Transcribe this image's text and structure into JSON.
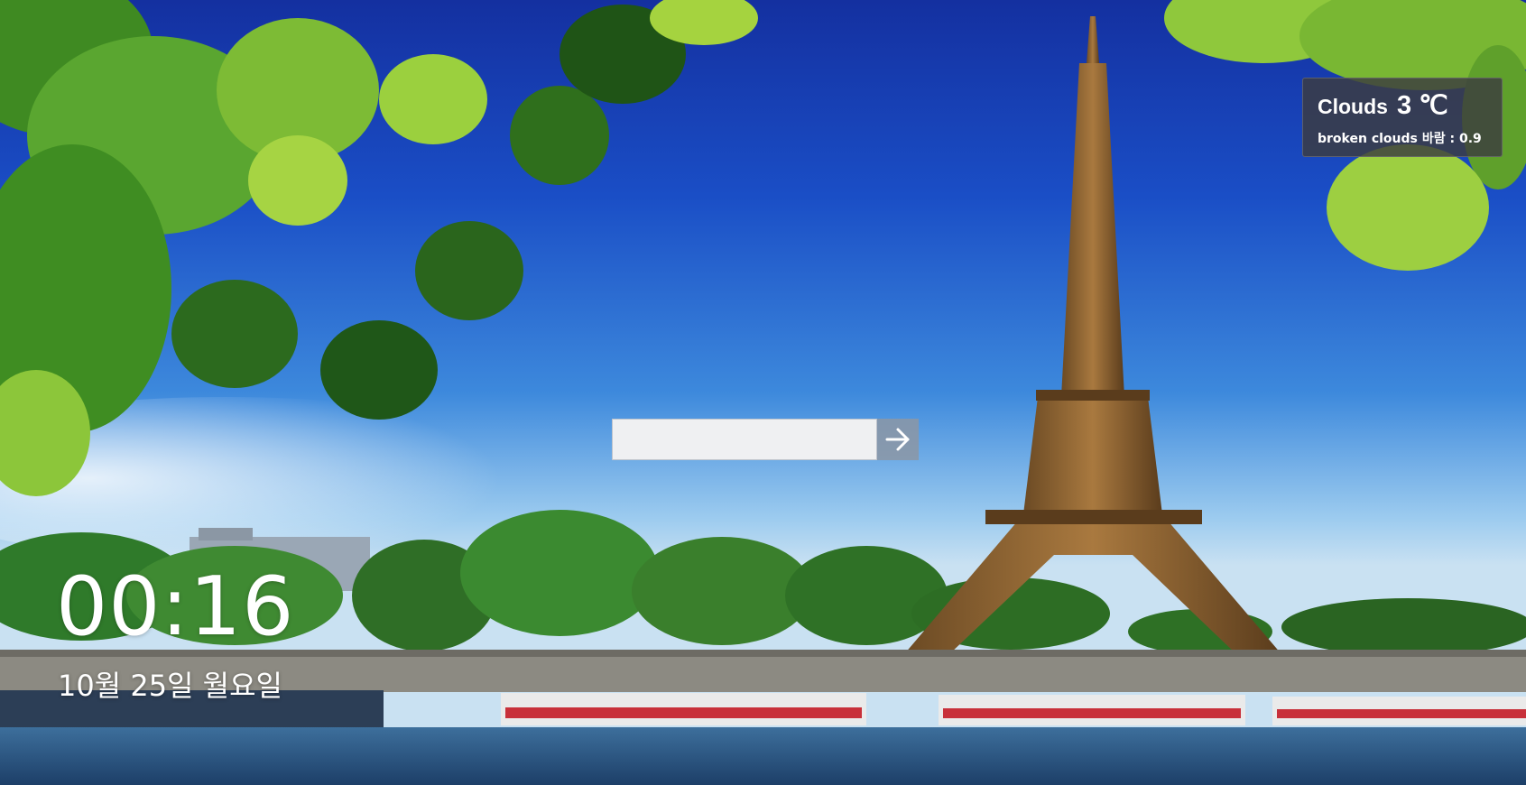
{
  "search": {
    "value": "",
    "placeholder": ""
  },
  "weather": {
    "condition": "Clouds",
    "temperature": "3 ℃",
    "description": "broken clouds",
    "wind": "바람 : 0.9"
  },
  "clock": {
    "time": "00:16",
    "date": "10월 25일 월요일"
  },
  "icons": {
    "search_submit": "arrow-right-icon"
  },
  "colors": {
    "sky_top": "#1533a6",
    "sky_horizon": "#bcd9ef",
    "search_field_bg": "#eff0f2",
    "weather_panel_bg": "#3c3c40",
    "text": "#ffffff"
  }
}
